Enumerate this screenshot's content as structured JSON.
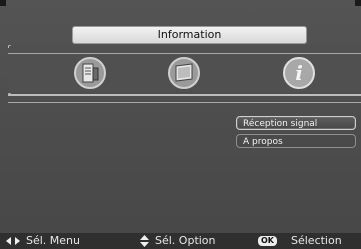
{
  "header": {
    "title": "Information"
  },
  "icons": [
    {
      "name": "reception-signal-icon"
    },
    {
      "name": "monitor-icon"
    },
    {
      "name": "info-icon",
      "glyph": "i"
    }
  ],
  "menu": {
    "items": [
      {
        "label": "Réception signal",
        "selected": true
      },
      {
        "label": "A propos",
        "selected": false
      }
    ]
  },
  "footer": {
    "menu_hint": "Sél. Menu",
    "option_hint": "Sél. Option",
    "ok_label": "OK",
    "select_hint": "Sélection"
  },
  "colors": {
    "background": "#4a4a4a",
    "title_pill": "#e6e6e6",
    "footer": "#2f2f2f"
  }
}
